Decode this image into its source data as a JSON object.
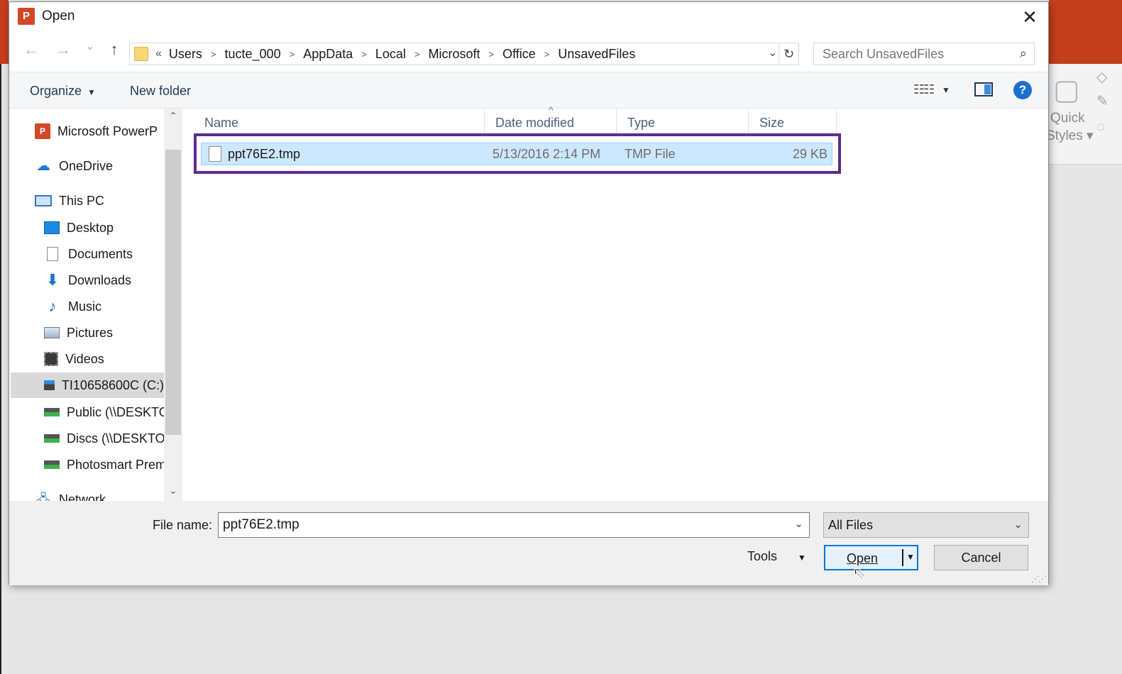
{
  "background": {
    "quick_styles_line1": "Quick",
    "quick_styles_line2": "Styles ▾"
  },
  "dialog": {
    "title": "Open",
    "close_glyph": "✕"
  },
  "nav": {
    "back_glyph": "←",
    "forward_glyph": "→",
    "recent_glyph": "⌄",
    "up_glyph": "↑"
  },
  "address": {
    "overflow": "«",
    "crumbs": [
      "Users",
      "tucte_000",
      "AppData",
      "Local",
      "Microsoft",
      "Office",
      "UnsavedFiles"
    ],
    "dropdown_glyph": "⌄",
    "refresh_glyph": "↻"
  },
  "search": {
    "placeholder": "Search UnsavedFiles",
    "icon": "⌕"
  },
  "toolbar": {
    "organize_label": "Organize",
    "organize_caret": "▼",
    "new_folder_label": "New folder",
    "view_glyph": "☷☷",
    "view_caret": "▼",
    "help_glyph": "?"
  },
  "navpane": {
    "items": [
      {
        "label": "Microsoft PowerP",
        "icon": "powerpoint-icon"
      },
      {
        "label": "OneDrive",
        "icon": "cloud-icon"
      },
      {
        "label": "This PC",
        "icon": "computer-icon"
      },
      {
        "label": "Desktop",
        "icon": "desktop-icon"
      },
      {
        "label": "Documents",
        "icon": "documents-icon"
      },
      {
        "label": "Downloads",
        "icon": "download-icon"
      },
      {
        "label": "Music",
        "icon": "music-icon"
      },
      {
        "label": "Pictures",
        "icon": "pictures-icon"
      },
      {
        "label": "Videos",
        "icon": "videos-icon"
      },
      {
        "label": "TI10658600C (C:)",
        "icon": "drive-icon"
      },
      {
        "label": "Public (\\\\DESKTO",
        "icon": "network-drive-icon"
      },
      {
        "label": "Discs (\\\\DESKTO",
        "icon": "network-drive-icon"
      },
      {
        "label": "Photosmart Prem",
        "icon": "network-drive-icon"
      },
      {
        "label": "Network",
        "icon": "network-icon"
      }
    ],
    "ppt_icon_text": "P",
    "cloud_glyph": "☁",
    "download_glyph": "⬇",
    "music_glyph": "♪",
    "network_glyph": "🖧",
    "scroll_up_glyph": "⌃",
    "scroll_down_glyph": "⌄"
  },
  "filelist": {
    "sort_glyph": "^",
    "columns": {
      "name": "Name",
      "date": "Date modified",
      "type": "Type",
      "size": "Size"
    },
    "rows": [
      {
        "name": "ppt76E2.tmp",
        "date": "5/13/2016 2:14 PM",
        "type": "TMP File",
        "size": "29 KB"
      }
    ]
  },
  "bottom": {
    "filename_label": "File name:",
    "filename_value": "ppt76E2.tmp",
    "filename_dd": "⌄",
    "filetype_value": "All Files",
    "filetype_dd": "⌄",
    "tools_label": "Tools",
    "tools_caret": "▼",
    "open_label": "Open",
    "open_caret": "▼",
    "cancel_label": "Cancel",
    "cursor_glyph": "⇖",
    "grip_glyph": "⋰⋰"
  }
}
